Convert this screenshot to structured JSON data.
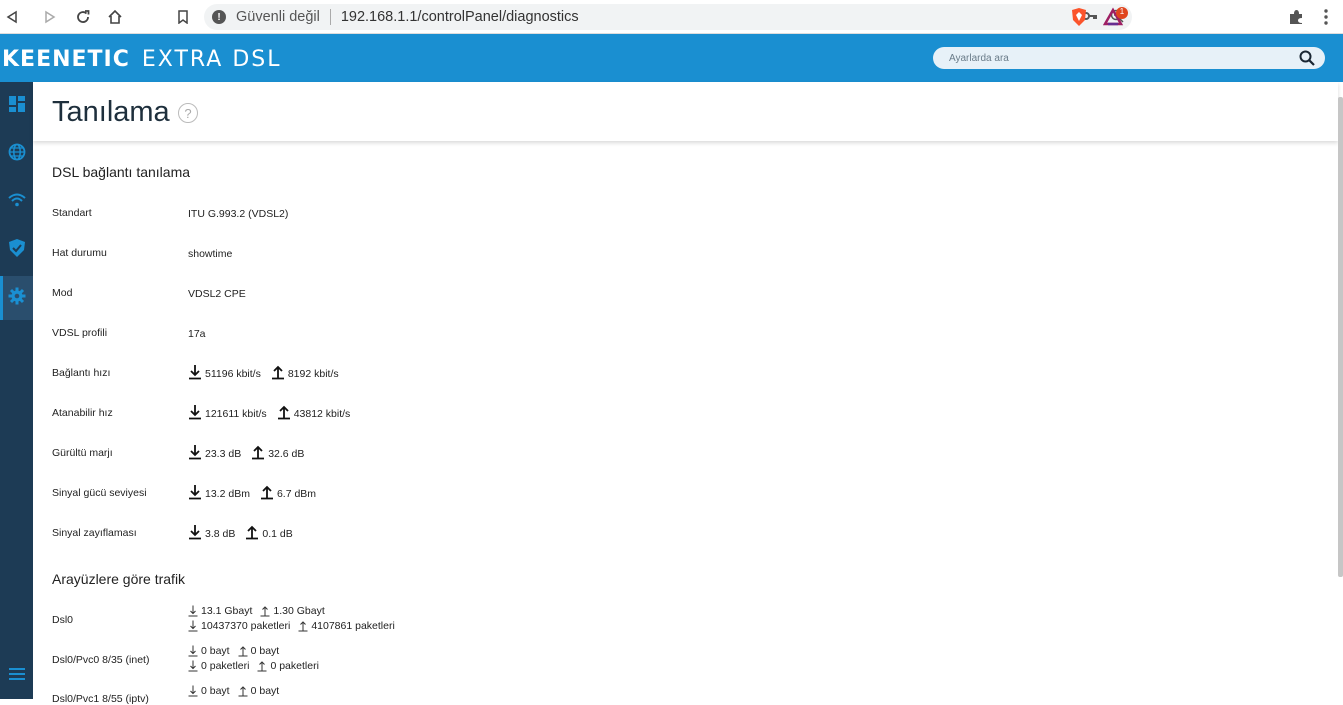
{
  "browser": {
    "security_label": "Güvenli değil",
    "url": "192.168.1.1/controlPanel/diagnostics",
    "badge_count": "1"
  },
  "app": {
    "brand": "KEENETIC",
    "model": "EXTRA DSL",
    "search_placeholder": "Ayarlarda ara"
  },
  "page": {
    "title": "Tanılama",
    "help": "?"
  },
  "dsl": {
    "section_title": "DSL bağlantı tanılama",
    "rows": {
      "standard": {
        "label": "Standart",
        "value": "ITU G.993.2 (VDSL2)"
      },
      "line_state": {
        "label": "Hat durumu",
        "value": "showtime"
      },
      "mode": {
        "label": "Mod",
        "value": "VDSL2 CPE"
      },
      "profile": {
        "label": "VDSL profili",
        "value": "17a"
      },
      "rate": {
        "label": "Bağlantı hızı",
        "down": "51196 kbit/s",
        "up": "8192 kbit/s"
      },
      "attainable": {
        "label": "Atanabilir hız",
        "down": "121611 kbit/s",
        "up": "43812 kbit/s"
      },
      "snr": {
        "label": "Gürültü marjı",
        "down": "23.3 dB",
        "up": "32.6 dB"
      },
      "power": {
        "label": "Sinyal gücü seviyesi",
        "down": "13.2 dBm",
        "up": "6.7 dBm"
      },
      "attenuation": {
        "label": "Sinyal zayıflaması",
        "down": "3.8 dB",
        "up": "0.1 dB"
      }
    }
  },
  "traffic": {
    "section_title": "Arayüzlere göre trafik",
    "interfaces": [
      {
        "label": "Dsl0",
        "bytes_down": "13.1 Gbayt",
        "bytes_up": "1.30 Gbayt",
        "pkts_down": "10437370 paketleri",
        "pkts_up": "4107861 paketleri"
      },
      {
        "label": "Dsl0/Pvc0 8/35 (inet)",
        "bytes_down": "0 bayt",
        "bytes_up": "0 bayt",
        "pkts_down": "0 paketleri",
        "pkts_up": "0 paketleri"
      },
      {
        "label": "Dsl0/Pvc1 8/55 (iptv)",
        "bytes_down": "0 bayt",
        "bytes_up": "0 bayt"
      }
    ]
  }
}
